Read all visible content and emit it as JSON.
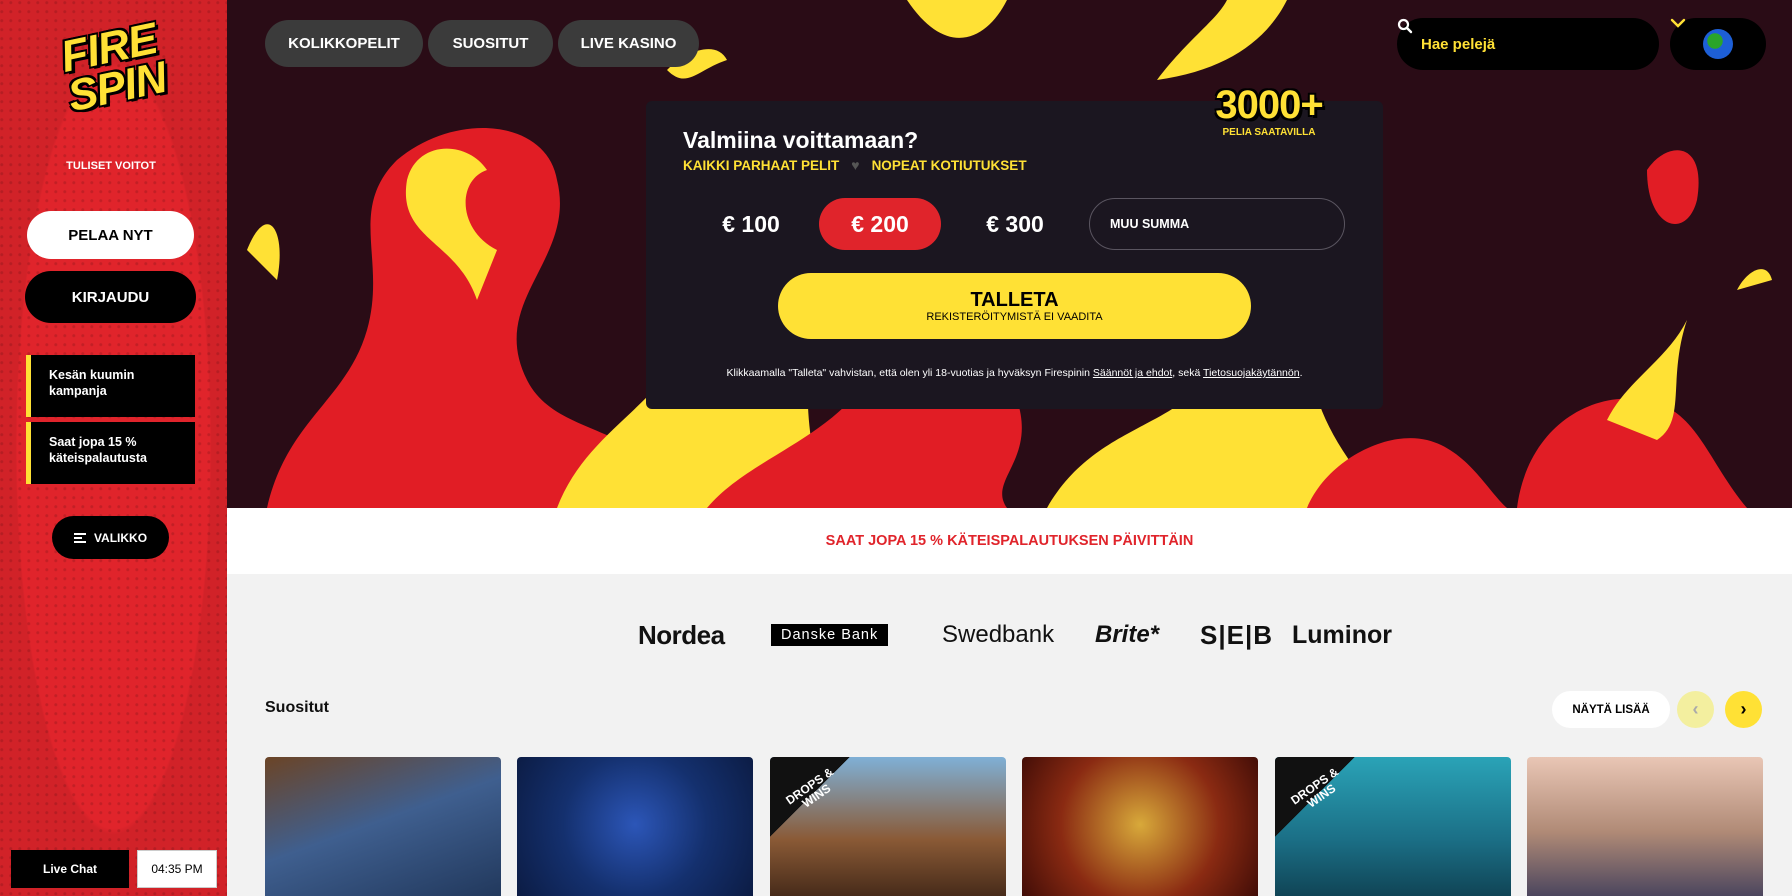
{
  "sidebar": {
    "logo_lines": [
      "FIRE",
      "SPIN"
    ],
    "tagline": "TULISET VOITOT",
    "play_label": "PELAA NYT",
    "login_label": "KIRJAUDU",
    "promos": [
      "Kesän kuumin kampanja",
      "Saat jopa 15 % käteispalautusta"
    ],
    "menu_label": "VALIKKO",
    "live_chat_label": "Live Chat",
    "clock": "04:35 PM"
  },
  "nav": {
    "items": [
      "KOLIKKOPELIT",
      "SUOSITUT",
      "LIVE KASINO"
    ],
    "search_placeholder": "Hae pelejä"
  },
  "deposit": {
    "title": "Valmiina voittamaan?",
    "sub_left": "KAIKKI PARHAAT PELIT",
    "sub_sep": "♥",
    "sub_right": "NOPEAT KOTIUTUKSET",
    "games_count": "3000+",
    "games_label": "PELIA SAATAVILLA",
    "amounts": [
      "€ 100",
      "€ 200",
      "€ 300"
    ],
    "selected_amount": "€ 200",
    "other_placeholder": "MUU SUMMA",
    "button_main": "TALLETA",
    "button_sub": "REKISTERÖITYMISTÄ EI VAADITA",
    "legal_prefix": "Klikkaamalla \"Talleta\" vahvistan, että olen yli 18-vuotias ja hyväksyn Firespinin ",
    "legal_link1": "Säännöt ja ehdot",
    "legal_middle": ", sekä ",
    "legal_link2": "Tietosuojakäytännön",
    "legal_suffix": "."
  },
  "cashback_banner": "SAAT JOPA 15 % KÄTEISPALAUTUKSEN PÄIVITTÄIN",
  "banks": [
    "Nordea",
    "Danske Bank",
    "Swedbank",
    "Brite*",
    "S|E|B",
    "Luminor"
  ],
  "popular": {
    "title": "Suositut",
    "more_label": "NÄYTÄ LISÄÄ",
    "prev_icon": "‹",
    "next_icon": "›",
    "badge_text": "DROPS & WINS"
  },
  "colors": {
    "brand_red": "#e0242b",
    "brand_yellow": "#ffe135",
    "dark": "#1b1620"
  }
}
